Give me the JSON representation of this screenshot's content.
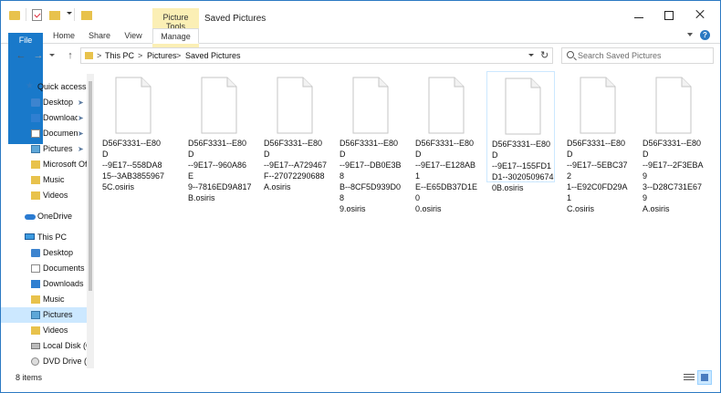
{
  "window": {
    "title": "Saved Pictures",
    "context_tab_group": "Picture Tools"
  },
  "ribbon": {
    "tabs": [
      {
        "label": "File"
      },
      {
        "label": "Home"
      },
      {
        "label": "Share"
      },
      {
        "label": "View"
      },
      {
        "label": "Manage"
      }
    ],
    "help_glyph": "?"
  },
  "address": {
    "crumbs": [
      "This PC",
      "Pictures",
      "Saved Pictures"
    ],
    "separator": ">"
  },
  "search": {
    "placeholder": "Search Saved Pictures"
  },
  "sidebar": {
    "items": [
      {
        "label": "Quick access",
        "icon": "star-icon"
      },
      {
        "label": "Desktop",
        "icon": "folder-icon",
        "pinned": true
      },
      {
        "label": "Downloads",
        "icon": "download-folder-icon",
        "pinned": true
      },
      {
        "label": "Documents",
        "icon": "documents-folder-icon",
        "pinned": true
      },
      {
        "label": "Pictures",
        "icon": "pictures-folder-icon",
        "pinned": true
      },
      {
        "label": "Microsoft Office",
        "icon": "folder-icon"
      },
      {
        "label": "Music",
        "icon": "music-folder-icon"
      },
      {
        "label": "Videos",
        "icon": "videos-folder-icon"
      },
      {
        "label": "OneDrive",
        "icon": "onedrive-icon"
      },
      {
        "label": "This PC",
        "icon": "computer-icon"
      },
      {
        "label": "Desktop",
        "icon": "folder-icon"
      },
      {
        "label": "Documents",
        "icon": "documents-folder-icon"
      },
      {
        "label": "Downloads",
        "icon": "download-folder-icon"
      },
      {
        "label": "Music",
        "icon": "music-folder-icon"
      },
      {
        "label": "Pictures",
        "icon": "pictures-folder-icon",
        "selected": true
      },
      {
        "label": "Videos",
        "icon": "videos-folder-icon"
      },
      {
        "label": "Local Disk (C:)",
        "icon": "drive-icon"
      },
      {
        "label": "DVD Drive (D:)",
        "icon": "dvd-icon"
      }
    ]
  },
  "files": [
    {
      "lines": [
        "D56F3331--E80D",
        "--9E17--558DA8",
        "15--3AB3855967",
        "5C.osiris"
      ]
    },
    {
      "lines": [
        "D56F3331--E80D",
        "--9E17--960A86E",
        "9--7816ED9A817",
        "B.osiris"
      ]
    },
    {
      "lines": [
        "D56F3331--E80D",
        "--9E17--A729467",
        "F--27072290688",
        "A.osiris"
      ]
    },
    {
      "lines": [
        "D56F3331--E80D",
        "--9E17--DB0E3B8",
        "B--8CF5D939D08",
        "9.osiris"
      ]
    },
    {
      "lines": [
        "D56F3331--E80D",
        "--9E17--E128AB1",
        "E--E65DB37D1E0",
        "0.osiris"
      ]
    },
    {
      "lines": [
        "D56F3331--E80D",
        "--9E17--155FD1",
        "D1--3020509674",
        "0B.osiris"
      ],
      "selected": true
    },
    {
      "lines": [
        "D56F3331--E80D",
        "--9E17--5EBC372",
        "1--E92C0FD29A1",
        "C.osiris"
      ]
    },
    {
      "lines": [
        "D56F3331--E80D",
        "--9E17--2F3EBA9",
        "3--D28C731E679",
        "A.osiris"
      ]
    }
  ],
  "status": {
    "item_count": "8 items"
  },
  "colors": {
    "accent": "#1979ca",
    "context_tab": "#fbefb5",
    "selection": "#cce8ff"
  }
}
